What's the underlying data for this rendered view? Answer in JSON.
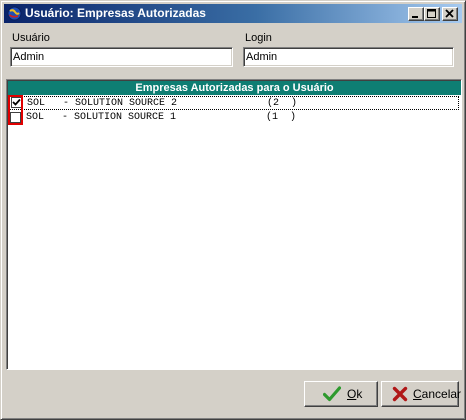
{
  "window": {
    "title": "Usuário: Empresas Autorizadas"
  },
  "fields": {
    "usuario_label": "Usuário",
    "usuario_value": "Admin",
    "login_label": "Login",
    "login_value": "Admin"
  },
  "list": {
    "header": "Empresas Autorizadas para o Usuário",
    "rows": [
      {
        "checked": true,
        "code": "SOL",
        "name": "- SOLUTION SOURCE 2",
        "num": "(2  )"
      },
      {
        "checked": false,
        "code": "SOL",
        "name": "- SOLUTION SOURCE 1",
        "num": "(1  )"
      }
    ]
  },
  "buttons": {
    "ok_accel": "O",
    "ok_rest": "k",
    "cancel_accel": "C",
    "cancel_rest": "ancelar"
  },
  "icons": {
    "app": "app-globe-icon",
    "minimize": "minimize-icon",
    "maximize": "maximize-icon",
    "close": "close-icon",
    "check": "checkmark-icon",
    "ok": "green-check-icon",
    "cancel": "red-x-icon"
  },
  "colors": {
    "titlebar_start": "#0a246a",
    "titlebar_end": "#a6caf0",
    "list_header": "#0e7e73",
    "highlight": "#e00000",
    "ok_icon": "#2e9a2e",
    "cancel_icon": "#b01818"
  }
}
